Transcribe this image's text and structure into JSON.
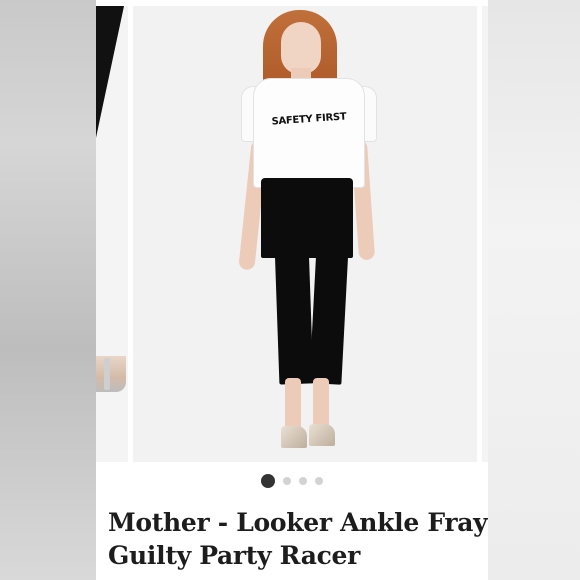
{
  "product": {
    "title": "Mother - Looker Ankle Fray Guilty Party Racer",
    "shirt_print": "SAFETY FIRST"
  },
  "carousel": {
    "slide_count": 4,
    "active_index": 0
  },
  "colors": {
    "page_bg": "#ffffff",
    "dot_active": "#333333",
    "dot_inactive": "#d3d3d3",
    "title_text": "#1d1d1d"
  }
}
